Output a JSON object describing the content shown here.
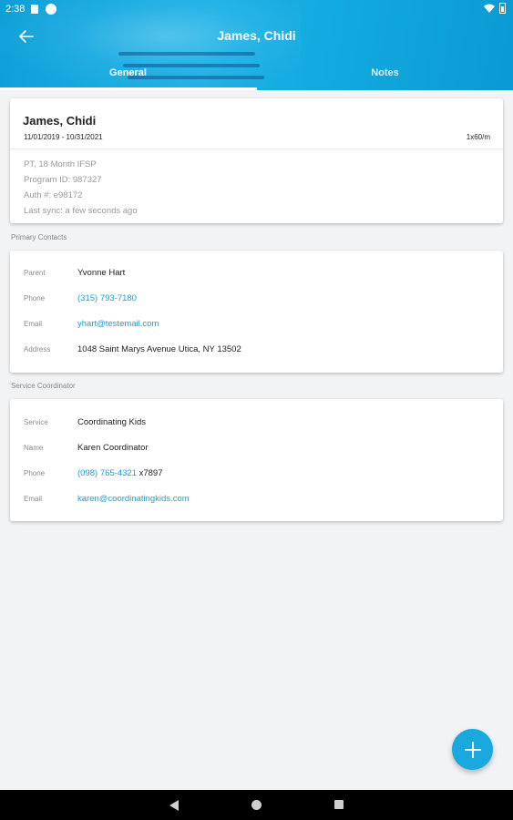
{
  "status_bar": {
    "time": "2:38"
  },
  "header": {
    "title": "James, Chidi",
    "tabs": [
      {
        "label": "General",
        "active": true
      },
      {
        "label": "Notes",
        "active": false
      }
    ]
  },
  "summary_card": {
    "name": "James, Chidi",
    "date_range": "11/01/2019 - 10/31/2021",
    "frequency": "1x60/m",
    "details": [
      "PT, 18 Month IFSP",
      "Program ID: 987327",
      "Auth #: e98172",
      "Last sync: a few seconds ago"
    ]
  },
  "primary_contacts": {
    "section_label": "Primary Contacts",
    "parent_label": "Parent",
    "parent_value": "Yvonne Hart",
    "phone_label": "Phone",
    "phone_value": "(315) 793-7180",
    "email_label": "Email",
    "email_value": "yhart@testemail.com",
    "address_label": "Address",
    "address_value": "1048  Saint Marys Avenue Utica, NY  13502"
  },
  "service_coordinator": {
    "section_label": "Service Coordinator",
    "service_label": "Service",
    "service_value": "Coordinating Kids",
    "name_label": "Name",
    "name_value": "Karen Coordinator",
    "phone_label": "Phone",
    "phone_value": "(098) 765-4321",
    "phone_ext": " x7897",
    "email_label": "Email",
    "email_value": "karen@coordinatingkids.com"
  },
  "colors": {
    "accent": "#1aa9df",
    "link": "#1a9fd6",
    "background": "#f2f3f5"
  },
  "icons": {
    "back": "arrow-left-icon",
    "fab": "plus-icon"
  }
}
